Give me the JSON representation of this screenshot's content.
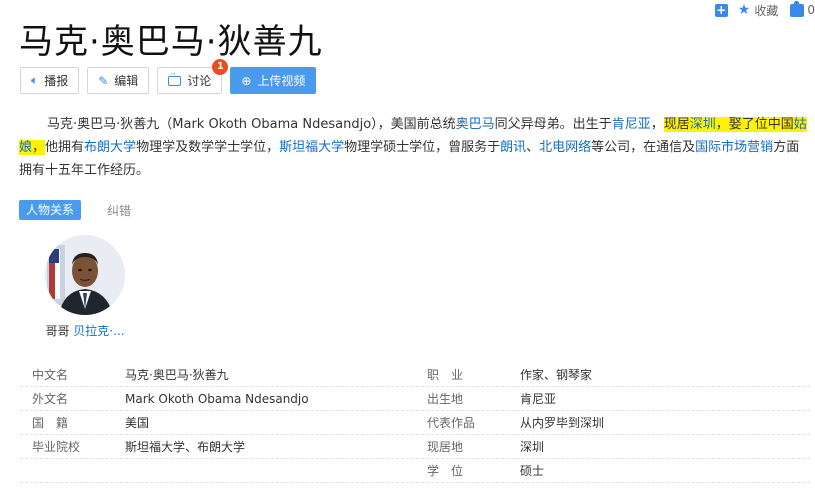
{
  "topbar": {
    "collect_label": "收藏",
    "like_count": "0"
  },
  "title": "马克·奥巴马·狄善九",
  "toolbar": {
    "broadcast": "播报",
    "edit": "编辑",
    "discuss": "讨论",
    "discuss_badge": "1",
    "upload_video": "上传视频"
  },
  "summary": {
    "p1": "马克·奥巴马·狄善九（Mark Okoth Obama Ndesandjo），美国前总统",
    "link_obama": "奥巴马",
    "p2": "同父异母弟。出生于",
    "link_kenya": "肯尼亚",
    "p3": "，",
    "hl1": "现居",
    "link_shenzhen": "深圳",
    "hl2": "，娶了位中国",
    "link_girl": "姑娘",
    "hl3": "，",
    "p4": "他拥有",
    "link_brown": "布朗大学",
    "p5": "物理学及数学学士学位，",
    "link_stanford": "斯坦福大学",
    "p6": "物理学硕士学位，曾服务于",
    "link_lx": "朗讯",
    "p7": "、",
    "link_nortel": "北电网络",
    "p8": "等公司，在通信及",
    "link_marketing": "国际市场营销",
    "p9": "方面拥有十五年工作经历。"
  },
  "relations": {
    "tab_active": "人物关系",
    "tab_correct": "纠错",
    "person_relation": "哥哥",
    "person_name": "贝拉克·..."
  },
  "info": {
    "rows": [
      {
        "k1": "中文名",
        "v1": "马克·奥巴马·狄善九",
        "k2": "职　业",
        "v2": "作家、钢琴家"
      },
      {
        "k1": "外文名",
        "v1": "Mark Okoth Obama Ndesandjo",
        "k2": "出生地",
        "v2": "肯尼亚"
      },
      {
        "k1": "国　籍",
        "v1": "美国",
        "k2": "代表作品",
        "v2": "从内罗毕到深圳"
      },
      {
        "k1": "毕业院校",
        "v1": "斯坦福大学、布朗大学",
        "k2": "现居地",
        "v2": "深圳"
      },
      {
        "k1": "",
        "v1": "",
        "k2": "学　位",
        "v2": "硕士"
      }
    ]
  },
  "colors": {
    "accent": "#4a9bee",
    "link": "#136ec2",
    "highlight": "#fff200",
    "badge": "#f04a23"
  }
}
